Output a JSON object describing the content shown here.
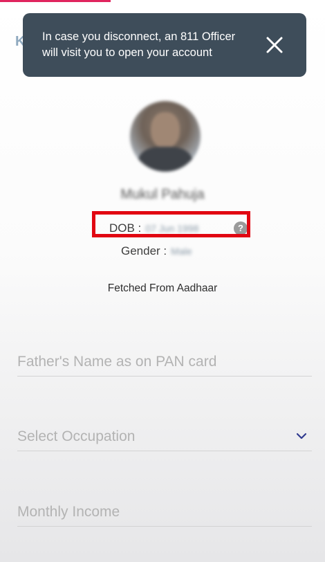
{
  "toast": {
    "message": "In case you disconnect, an 811 Officer will visit you to open your account"
  },
  "profile": {
    "name": "Mukul Pahuja",
    "dob_label": "DOB :",
    "dob_value": "07 Jun 1998",
    "gender_label": "Gender :",
    "gender_value": "Male",
    "source_note": "Fetched From Aadhaar"
  },
  "form": {
    "father_name_placeholder": "Father's Name as on PAN card",
    "occupation_placeholder": "Select Occupation",
    "income_placeholder": "Monthly Income"
  },
  "header": {
    "back_glyph": "K"
  },
  "icons": {
    "help": "?",
    "close": "close-icon",
    "dropdown": "chevron-down-icon"
  },
  "colors": {
    "accent": "#e0245e",
    "toast_bg": "#3e4d5a",
    "highlight": "#e10612",
    "chevron": "#2f3a8f"
  }
}
